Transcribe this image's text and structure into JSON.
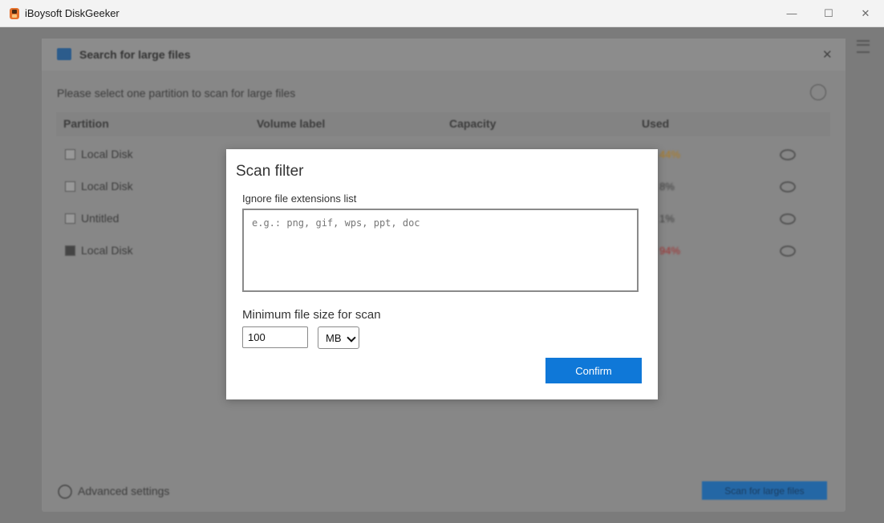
{
  "window": {
    "title": "iBoysoft DiskGeeker",
    "controls": {
      "minimize": "—",
      "maximize": "☐",
      "close": "✕"
    }
  },
  "background_panel": {
    "title": "Search for large files",
    "instruction": "Please select one partition to scan for large files",
    "columns": [
      "Partition",
      "Volume label",
      "Capacity",
      "Used"
    ],
    "rows": [
      {
        "partition": "Local Disk",
        "used": "44%",
        "used_color": "#b07a1a",
        "checked": false
      },
      {
        "partition": "Local Disk",
        "used": "8%",
        "used_color": "#3c3c3c",
        "checked": false
      },
      {
        "partition": "Untitled",
        "used": "1%",
        "used_color": "#3c3c3c",
        "checked": false
      },
      {
        "partition": "Local Disk",
        "used": "94%",
        "used_color": "#a02a2a",
        "checked": true
      }
    ],
    "advanced_settings": "Advanced settings",
    "scan_button": "Scan for large files"
  },
  "dialog": {
    "title": "Scan filter",
    "extensions_label": "Ignore file extensions list",
    "extensions_placeholder": "e.g.: png, gif, wps, ppt, doc",
    "extensions_value": "",
    "min_size_label": "Minimum file size for scan",
    "min_size_value": "100",
    "unit_selected": "MB",
    "confirm_label": "Confirm"
  },
  "colors": {
    "accent": "#0f78d8",
    "warning": "#b07a1a",
    "danger": "#a02a2a"
  }
}
